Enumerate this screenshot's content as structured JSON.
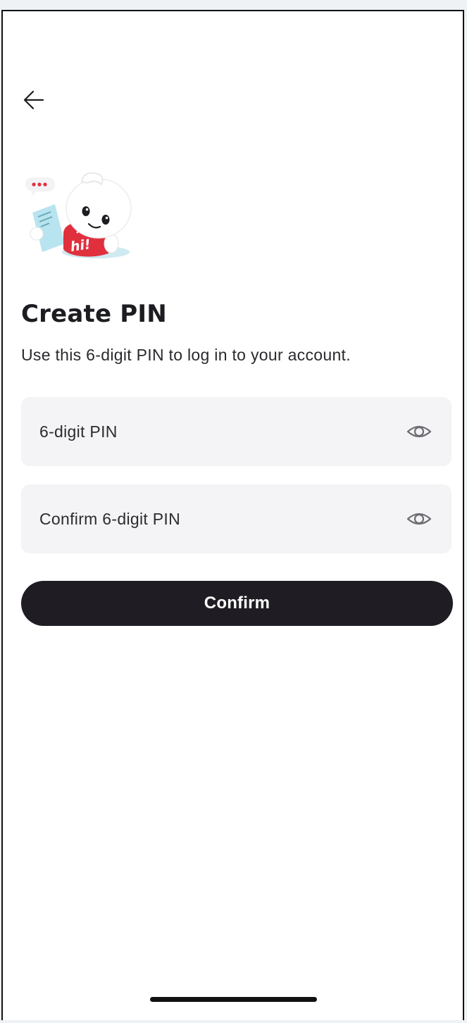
{
  "header": {
    "back_icon": "arrow-left-icon"
  },
  "illustration": {
    "badge_text": "hi!"
  },
  "main": {
    "title": "Create PIN",
    "subtitle": "Use this 6-digit PIN to log in to your account."
  },
  "form": {
    "pin_field": {
      "placeholder": "6-digit PIN",
      "value": "",
      "toggle_icon": "eye-icon"
    },
    "confirm_pin_field": {
      "placeholder": "Confirm 6-digit PIN",
      "value": "",
      "toggle_icon": "eye-icon"
    },
    "confirm_button_label": "Confirm"
  },
  "colors": {
    "button_background": "#1f1d23",
    "field_background": "#f4f4f6",
    "mascot_accent": "#e0303e",
    "mascot_card": "#b8e4ef"
  }
}
